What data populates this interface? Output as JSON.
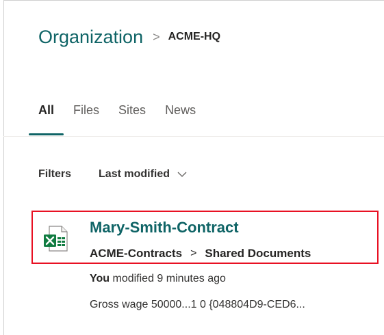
{
  "breadcrumb": {
    "root": "Organization",
    "separator": ">",
    "current": "ACME-HQ"
  },
  "tabs": [
    {
      "label": "All",
      "active": true
    },
    {
      "label": "Files",
      "active": false
    },
    {
      "label": "Sites",
      "active": false
    },
    {
      "label": "News",
      "active": false
    }
  ],
  "filters": {
    "label": "Filters",
    "sort_label": "Last modified",
    "sort_icon": "chevron-down-icon"
  },
  "result": {
    "icon": "excel-file-icon",
    "title": "Mary-Smith-Contract",
    "path": [
      "ACME-Contracts",
      "Shared Documents"
    ],
    "path_separator": ">",
    "modified_by": "You",
    "modified_text": "modified 9 minutes ago",
    "snippet": "Gross wage 50000...1 0 {048804D9-CED6..."
  },
  "colors": {
    "accent": "#0f6466",
    "highlight_border": "#e81123",
    "excel_green": "#107c41"
  }
}
